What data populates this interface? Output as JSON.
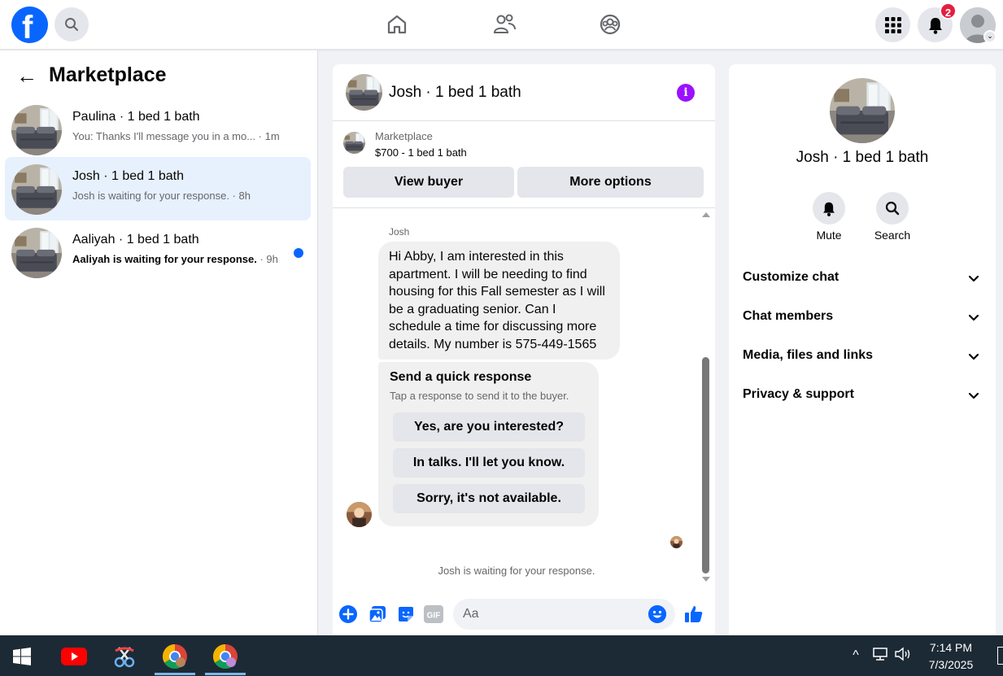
{
  "colors": {
    "brand": "#0866ff",
    "active_bg": "#e7f0fd",
    "badge": "#e41e3f",
    "info": "#9b11ff",
    "taskbar": "#1c2a36"
  },
  "topbar": {
    "notifications_count": "2"
  },
  "left": {
    "title": "Marketplace",
    "conversations": [
      {
        "name": "Paulina · 1 bed 1 bath",
        "preview": "You: Thanks I'll message you in a mo...",
        "time": " · 1m",
        "unread": false
      },
      {
        "name": "Josh · 1 bed 1 bath",
        "preview": "Josh is waiting for your response.",
        "time": " · 8h",
        "unread": false
      },
      {
        "name": "Aaliyah · 1 bed 1 bath",
        "preview": "Aaliyah is waiting for your response.",
        "time": " · 9h",
        "unread": true
      }
    ]
  },
  "chat": {
    "title": "Josh · 1 bed 1 bath",
    "listing": {
      "category": "Marketplace",
      "price_line": "$700 - 1 bed 1 bath",
      "view_buyer": "View buyer",
      "more_options": "More options"
    },
    "sender": "Josh",
    "message": "Hi Abby, I am interested in this apartment. I will be needing to find housing for this Fall semester as I will be a graduating senior. Can I schedule a time for discussing more details. My number is 575-449-1565",
    "quick": {
      "title": "Send a quick response",
      "subtitle": "Tap a response to send it to the buyer.",
      "options": [
        "Yes, are you interested?",
        "In talks. I'll let you know.",
        "Sorry, it's not available."
      ]
    },
    "waiting": "Josh is waiting for your response.",
    "composer": {
      "placeholder": "Aa"
    }
  },
  "right": {
    "name": "Josh · 1 bed 1 bath",
    "actions": {
      "mute": "Mute",
      "search": "Search"
    },
    "sections": [
      "Customize chat",
      "Chat members",
      "Media, files and links",
      "Privacy & support"
    ]
  },
  "taskbar": {
    "time": "7:14 PM",
    "date": "7/3/2025"
  }
}
